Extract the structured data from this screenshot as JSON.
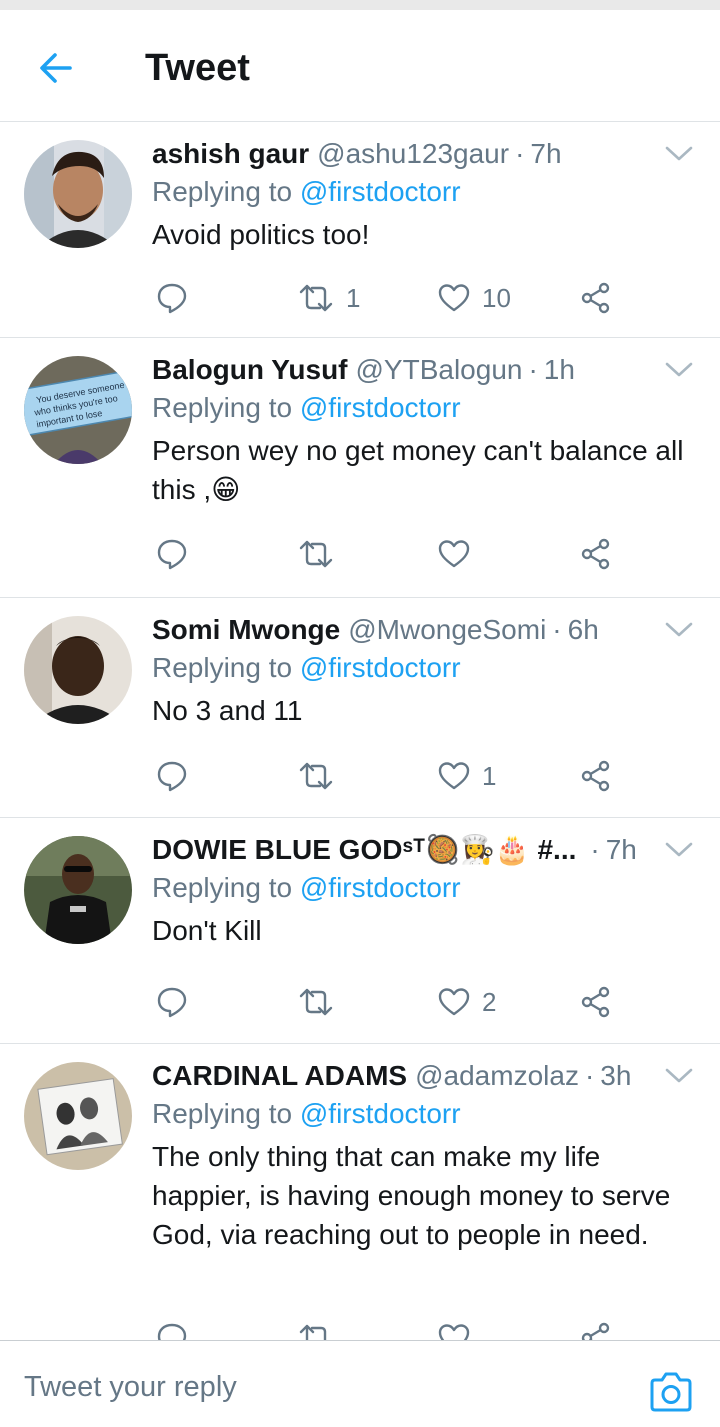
{
  "header": {
    "title": "Tweet"
  },
  "tweets": [
    {
      "name": "ashish gaur",
      "handle": "@ashu123gaur",
      "time": "7h",
      "replying_prefix": "Replying to ",
      "replying_to": "@firstdoctorr",
      "text": "Avoid politics too!",
      "retweets": "1",
      "likes": "10"
    },
    {
      "name": "Balogun Yusuf",
      "handle": "@YTBalogun",
      "time": "1h",
      "replying_prefix": "Replying to ",
      "replying_to": "@firstdoctorr",
      "text": "Person wey no get money can't balance all this ,😁",
      "retweets": "",
      "likes": "",
      "avatar_text": [
        "You deserve someone",
        "who thinks you're too",
        "important to lose"
      ]
    },
    {
      "name": "Somi Mwonge",
      "handle": "@MwongeSomi",
      "time": "6h",
      "replying_prefix": "Replying to ",
      "replying_to": "@firstdoctorr",
      "text": "No 3 and 11",
      "retweets": "",
      "likes": "1"
    },
    {
      "name": "DOWIE BLUE GODˢᵀ🥘👩‍🍳🎂 #...",
      "handle": "",
      "time": "7h",
      "replying_prefix": "Replying to ",
      "replying_to": "@firstdoctorr",
      "text": "Don't Kill",
      "retweets": "",
      "likes": "2"
    },
    {
      "name": "CARDINAL ADAMS",
      "handle": "@adamzolaz",
      "time": "3h",
      "replying_prefix": "Replying to ",
      "replying_to": "@firstdoctorr",
      "text": "The only thing that can make my life happier,  is having enough money to serve God, via reaching out to people in need.",
      "retweets": "",
      "likes": ""
    }
  ],
  "composer": {
    "placeholder": "Tweet your reply"
  },
  "icons": {
    "back": "arrow-left-icon",
    "reply": "reply-icon",
    "retweet": "retweet-icon",
    "like": "heart-icon",
    "share": "share-icon",
    "more": "chevron-down-icon",
    "camera": "camera-icon"
  },
  "colors": {
    "accent": "#1da1f2",
    "secondary_text": "#657786",
    "divider": "#dfe3e6"
  }
}
